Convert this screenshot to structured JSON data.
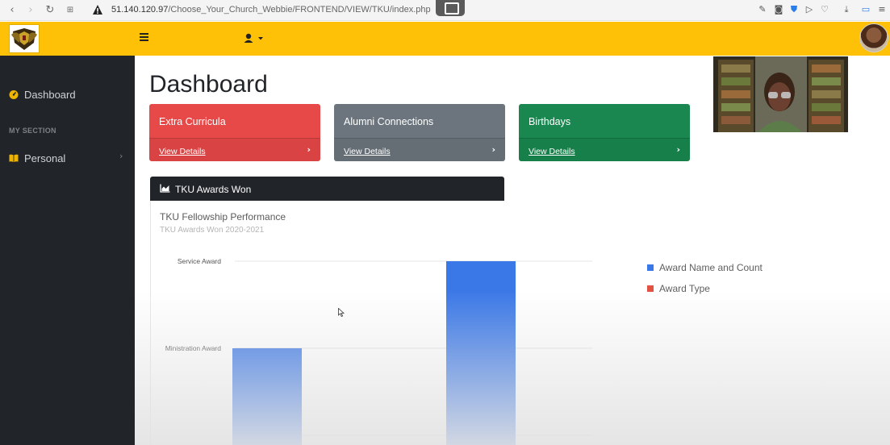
{
  "browser": {
    "back_icon": "chevron-left-icon",
    "forward_icon": "chevron-right-icon",
    "reload_icon": "reload-icon",
    "url_host": "51.140.120.97",
    "url_path": "/Choose_Your_Church_Webbie/FRONTEND/VIEW/TKU/index.php"
  },
  "topbar": {
    "color": "#ffc107",
    "menu_icon": "hamburger-icon",
    "user_icon": "user-icon"
  },
  "sidebar": {
    "items": [
      {
        "label": "Dashboard",
        "icon": "gauge-icon"
      },
      {
        "label": "Personal",
        "icon": "book-icon"
      }
    ],
    "section_heading": "MY SECTION"
  },
  "main": {
    "title": "Dashboard",
    "cards": [
      {
        "title": "Extra Curricula",
        "link": "View Details",
        "color": "#e74848"
      },
      {
        "title": "Alumni Connections",
        "link": "View Details",
        "color": "#6c757d"
      },
      {
        "title": "Birthdays",
        "link": "View Details",
        "color": "#19874f"
      }
    ],
    "chart_panel": {
      "header": "TKU Awards Won",
      "title": "TKU Fellowship Performance",
      "subtitle": "TKU Awards Won 2020-2021"
    }
  },
  "chart_data": {
    "type": "bar",
    "title": "TKU Fellowship Performance",
    "subtitle": "TKU Awards Won 2020-2021",
    "y_tick_labels": [
      "Service Award",
      "Ministration Award"
    ],
    "categories": [
      "",
      ""
    ],
    "series": [
      {
        "name": "Award Name and Count",
        "color": "#3b78e7",
        "values": [
          1,
          2
        ]
      },
      {
        "name": "Award Type",
        "color": "#e15241",
        "values": []
      }
    ],
    "ylim": [
      0,
      2
    ],
    "grid": true,
    "legend_position": "right"
  }
}
